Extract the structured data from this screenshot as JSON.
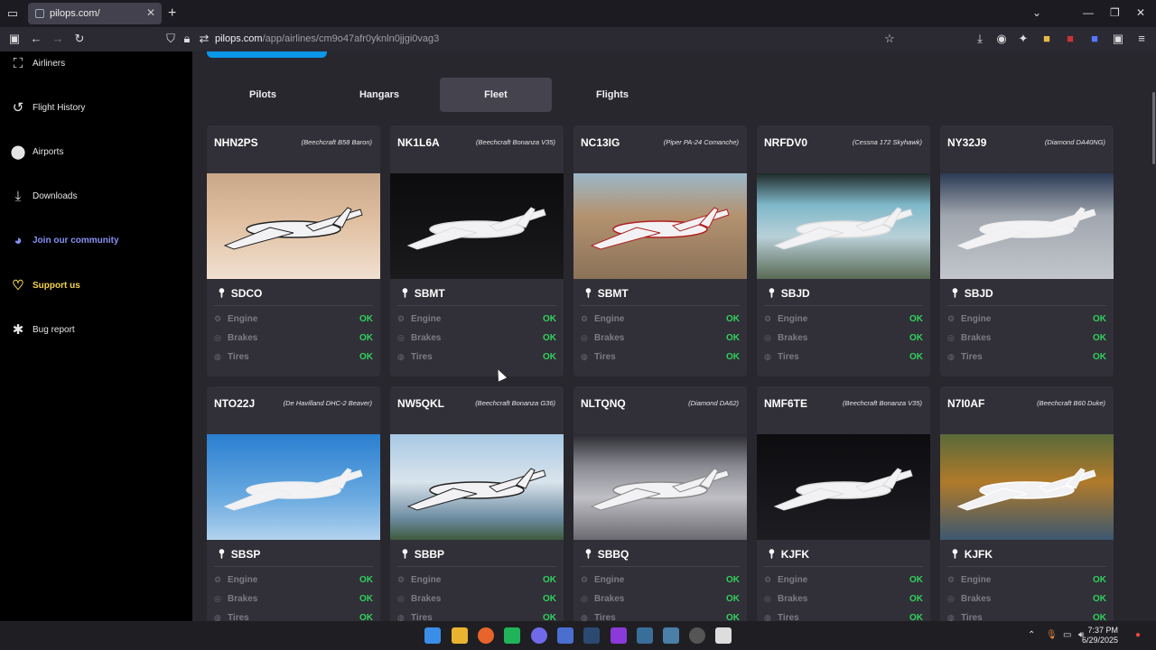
{
  "browser": {
    "tab_title": "pilops.com/",
    "url_host": "pilops.com",
    "url_path": "/app/airlines/cm9o47afr0yknln0jjgi0vag3"
  },
  "sidebar": {
    "items": [
      {
        "label": "Airliners",
        "icon": "airliner-icon"
      },
      {
        "label": "Flight History",
        "icon": "history-icon"
      },
      {
        "label": "Airports",
        "icon": "location-pin-icon"
      },
      {
        "label": "Downloads",
        "icon": "download-icon"
      },
      {
        "label": "Join our community",
        "icon": "discord-icon"
      },
      {
        "label": "Support us",
        "icon": "heart-icon"
      },
      {
        "label": "Bug report",
        "icon": "bug-icon"
      }
    ]
  },
  "main": {
    "tabs": [
      "Pilots",
      "Hangars",
      "Fleet",
      "Flights"
    ],
    "active_tab": "Fleet",
    "status_labels": {
      "engine": "Engine",
      "brakes": "Brakes",
      "tires": "Tires"
    },
    "aircraft": [
      {
        "reg": "NHN2PS",
        "model": "(Beechcraft B58 Baron)",
        "location": "SDCO",
        "engine": "OK",
        "brakes": "OK",
        "tires": "OK"
      },
      {
        "reg": "NK1L6A",
        "model": "(Beechcraft Bonanza V35)",
        "location": "SBMT",
        "engine": "OK",
        "brakes": "OK",
        "tires": "OK"
      },
      {
        "reg": "NC13IG",
        "model": "(Piper PA-24 Comanche)",
        "location": "SBMT",
        "engine": "OK",
        "brakes": "OK",
        "tires": "OK"
      },
      {
        "reg": "NRFDV0",
        "model": "(Cessna 172 Skyhawk)",
        "location": "SBJD",
        "engine": "OK",
        "brakes": "OK",
        "tires": "OK"
      },
      {
        "reg": "NY32J9",
        "model": "(Diamond DA40NG)",
        "location": "SBJD",
        "engine": "OK",
        "brakes": "OK",
        "tires": "OK"
      },
      {
        "reg": "NTO22J",
        "model": "(De Havilland DHC-2 Beaver)",
        "location": "SBSP",
        "engine": "OK",
        "brakes": "OK",
        "tires": "OK"
      },
      {
        "reg": "NW5QKL",
        "model": "(Beechcraft Bonanza G36)",
        "location": "SBBP",
        "engine": "OK",
        "brakes": "OK",
        "tires": "OK"
      },
      {
        "reg": "NLTQNQ",
        "model": "(Diamond DA62)",
        "location": "SBBQ",
        "engine": "OK",
        "brakes": "OK",
        "tires": "OK"
      },
      {
        "reg": "NMF6TE",
        "model": "(Beechcraft Bonanza V35)",
        "location": "KJFK",
        "engine": "OK",
        "brakes": "OK",
        "tires": "OK"
      },
      {
        "reg": "N7I0AF",
        "model": "(Beechcraft B60 Duke)",
        "location": "KJFK",
        "engine": "OK",
        "brakes": "OK",
        "tires": "OK"
      }
    ]
  },
  "taskbar": {
    "time": "7:37 PM",
    "date": "6/29/2025"
  },
  "colors": {
    "accent": "#0b96e8",
    "ok": "#31d05c",
    "discord": "#8891f2",
    "support": "#f5d24a"
  }
}
